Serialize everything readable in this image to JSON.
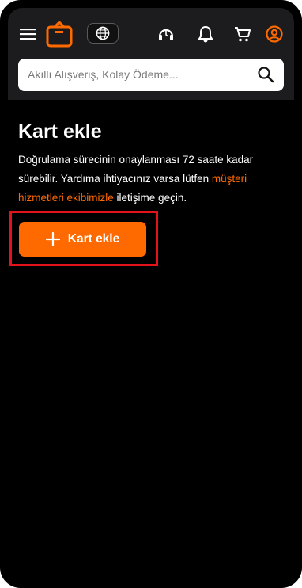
{
  "header": {
    "icons": [
      "menu-icon",
      "logo-icon",
      "globe-icon",
      "support-icon",
      "bell-icon",
      "cart-icon",
      "user-icon"
    ]
  },
  "search": {
    "placeholder": "Akıllı Alışveriş, Kolay Ödeme..."
  },
  "main": {
    "title": "Kart ekle",
    "description_before": "Doğrulama sürecinin onaylanması 72 saate kadar sürebilir. Yardıma ihtiyacınız varsa lütfen ",
    "description_link": "müşteri hizmetleri ekibimizle",
    "description_after": " iletişime geçin.",
    "add_card_label": "Kart ekle"
  },
  "colors": {
    "accent": "#ff6a00",
    "background": "#000000",
    "header_bg": "#1c1c1e",
    "highlight": "#e3121b"
  }
}
